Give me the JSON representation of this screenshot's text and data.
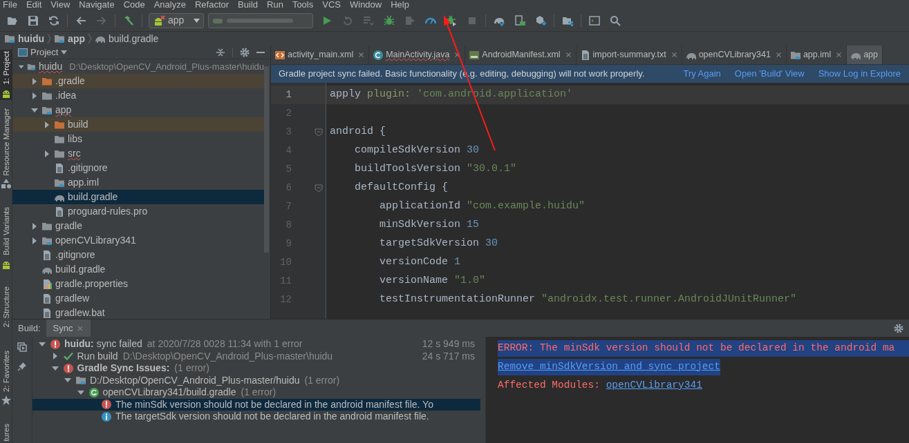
{
  "menu": [
    {
      "label": "File"
    },
    {
      "label": "Edit"
    },
    {
      "label": "View"
    },
    {
      "label": "Navigate"
    },
    {
      "label": "Code"
    },
    {
      "label": "Analyze"
    },
    {
      "label": "Refactor"
    },
    {
      "label": "Build"
    },
    {
      "label": "Run"
    },
    {
      "label": "Tools"
    },
    {
      "label": "VCS"
    },
    {
      "label": "Window"
    },
    {
      "label": "Help"
    }
  ],
  "toolbar": {
    "run_config": {
      "label": "app",
      "error": true
    }
  },
  "breadcrumb": [
    {
      "label": "huidu",
      "kind": "module",
      "bold": true
    },
    {
      "label": "app",
      "kind": "module",
      "bold": true
    },
    {
      "label": "build.gradle",
      "kind": "gradle",
      "bold": false
    }
  ],
  "tool_stripe": [
    {
      "label": "1: Project",
      "selected": true
    },
    {
      "label": "Resource Manager",
      "selected": false
    },
    {
      "label": "Build Variants",
      "selected": false
    },
    {
      "label": "2: Structure",
      "selected": false
    },
    {
      "label": "2: Favorites",
      "selected": false
    },
    {
      "label": "tures",
      "selected": false
    }
  ],
  "project_panel": {
    "title": "Project",
    "tree": [
      {
        "label": "huidu",
        "detail": "D:\\Desktop\\OpenCV_Android_Plus-master\\huidu",
        "kind": "module",
        "expanded": true,
        "error": true,
        "excluded": false,
        "selected": false,
        "children": [
          {
            "label": ".gradle",
            "kind": "folder",
            "expanded": false,
            "error": false,
            "excluded": true,
            "selected": false
          },
          {
            "label": ".idea",
            "kind": "folder",
            "expanded": false,
            "error": false,
            "excluded": false,
            "selected": false
          },
          {
            "label": "app",
            "kind": "module",
            "expanded": true,
            "error": true,
            "excluded": false,
            "selected": false,
            "children": [
              {
                "label": "build",
                "kind": "folder",
                "expanded": false,
                "error": false,
                "excluded": true,
                "selected": false
              },
              {
                "label": "libs",
                "kind": "folder",
                "error": false,
                "excluded": false,
                "selected": false
              },
              {
                "label": "src",
                "kind": "folder",
                "expanded": false,
                "error": true,
                "excluded": false,
                "selected": false
              },
              {
                "label": ".gitignore",
                "kind": "file",
                "error": false,
                "excluded": false,
                "selected": false
              },
              {
                "label": "app.iml",
                "kind": "module",
                "error": false,
                "excluded": false,
                "selected": false
              },
              {
                "label": "build.gradle",
                "kind": "gradle",
                "error": false,
                "excluded": false,
                "selected": true
              },
              {
                "label": "proguard-rules.pro",
                "kind": "file",
                "error": false,
                "excluded": false,
                "selected": false
              }
            ]
          },
          {
            "label": "gradle",
            "kind": "folder",
            "expanded": false,
            "error": false,
            "excluded": false,
            "selected": false
          },
          {
            "label": "openCVLibrary341",
            "kind": "module",
            "expanded": false,
            "error": false,
            "excluded": false,
            "selected": false
          },
          {
            "label": ".gitignore",
            "kind": "file",
            "error": false,
            "excluded": false,
            "selected": false
          },
          {
            "label": "build.gradle",
            "kind": "gradle",
            "error": false,
            "excluded": false,
            "selected": false
          },
          {
            "label": "gradle.properties",
            "kind": "properties",
            "error": false,
            "excluded": false,
            "selected": false
          },
          {
            "label": "gradlew",
            "kind": "file",
            "error": false,
            "excluded": false,
            "selected": false
          },
          {
            "label": "gradlew.bat",
            "kind": "file",
            "error": false,
            "excluded": false,
            "selected": false
          }
        ]
      }
    ]
  },
  "editor_tabs": [
    {
      "label": "activity_main.xml",
      "kind": "layout",
      "selected": false,
      "error": false
    },
    {
      "label": "MainActivity.java",
      "kind": "java",
      "selected": false,
      "error": true
    },
    {
      "label": "AndroidManifest.xml",
      "kind": "manifest",
      "selected": false,
      "error": false
    },
    {
      "label": "import-summary.txt",
      "kind": "file",
      "selected": false,
      "error": false
    },
    {
      "label": "openCVLibrary341",
      "kind": "gradle",
      "selected": false,
      "error": false
    },
    {
      "label": "app.iml",
      "kind": "module",
      "selected": false,
      "error": false
    },
    {
      "label": "app",
      "kind": "gradle",
      "selected": true,
      "error": false
    }
  ],
  "banner": {
    "message": "Gradle project sync failed. Basic functionality (e.g. editing, debugging) will not work properly.",
    "links": [
      "Try Again",
      "Open 'Build' View",
      "Show Log in Explore"
    ]
  },
  "code": [
    {
      "number": "1",
      "current": true,
      "fold": false,
      "tokens": [
        {
          "kind": "plain",
          "text": "apply "
        },
        {
          "kind": "label",
          "text": "plugin: "
        },
        {
          "kind": "string",
          "text": "'com.android.application'"
        }
      ]
    },
    {
      "number": "2",
      "current": false,
      "fold": false
    },
    {
      "number": "3",
      "current": false,
      "fold": true,
      "tokens": [
        {
          "kind": "plain",
          "text": "android {"
        }
      ]
    },
    {
      "number": "4",
      "current": false,
      "fold": false,
      "tokens": [
        {
          "kind": "plain",
          "text": "    compileSdkVersion "
        },
        {
          "kind": "number",
          "text": "30"
        }
      ]
    },
    {
      "number": "5",
      "current": false,
      "fold": false,
      "tokens": [
        {
          "kind": "plain",
          "text": "    buildToolsVersion "
        },
        {
          "kind": "string",
          "text": "\"30.0.1\""
        }
      ]
    },
    {
      "number": "6",
      "current": false,
      "fold": true,
      "tokens": [
        {
          "kind": "plain",
          "text": "    defaultConfig {"
        }
      ]
    },
    {
      "number": "7",
      "current": false,
      "fold": false,
      "tokens": [
        {
          "kind": "plain",
          "text": "        applicationId "
        },
        {
          "kind": "string",
          "text": "\"com.example.huidu\""
        }
      ]
    },
    {
      "number": "8",
      "current": false,
      "fold": false,
      "tokens": [
        {
          "kind": "plain",
          "text": "        minSdkVersion "
        },
        {
          "kind": "number",
          "text": "15"
        }
      ]
    },
    {
      "number": "9",
      "current": false,
      "fold": false,
      "tokens": [
        {
          "kind": "plain",
          "text": "        targetSdkVersion "
        },
        {
          "kind": "number",
          "text": "30"
        }
      ]
    },
    {
      "number": "10",
      "current": false,
      "fold": false,
      "tokens": [
        {
          "kind": "plain",
          "text": "        versionCode "
        },
        {
          "kind": "number",
          "text": "1"
        }
      ]
    },
    {
      "number": "11",
      "current": false,
      "fold": false,
      "tokens": [
        {
          "kind": "plain",
          "text": "        versionName "
        },
        {
          "kind": "string",
          "text": "\"1.0\""
        }
      ]
    },
    {
      "number": "12",
      "current": false,
      "fold": false,
      "tokens": [
        {
          "kind": "plain",
          "text": "        testInstrumentationRunner "
        },
        {
          "kind": "string",
          "text": "\"androidx.test.runner.AndroidJUnitRunner\""
        }
      ]
    }
  ],
  "build_panel": {
    "label": "Build:",
    "tabs": [
      {
        "label": "Sync",
        "selected": true
      }
    ],
    "tree": [
      {
        "kind": "error",
        "title": "**huidu:** sync failed",
        "bold": false,
        "detail": "at 2020/7/28 0028 11:34  with 1 error",
        "duration": "12 s 949 ms",
        "expanded": true,
        "selected": false,
        "children": [
          {
            "kind": "success",
            "title": "Run build",
            "bold": false,
            "detail": "D:\\Desktop\\OpenCV_Android_Plus-master\\huidu",
            "duration": "24 s 717 ms",
            "expanded": false,
            "selected": false
          },
          {
            "kind": "error",
            "title": "Gradle Sync Issues:",
            "bold": true,
            "detail": "(1 error)",
            "expanded": true,
            "selected": false,
            "children": [
              {
                "kind": "module",
                "title": "D:/Desktop/OpenCV_Android_Plus-master/huidu",
                "bold": false,
                "detail": "(1 error)",
                "expanded": true,
                "selected": false,
                "children": [
                  {
                    "kind": "gradle-file",
                    "title": "openCVLibrary341/build.gradle",
                    "bold": false,
                    "detail": "(1 error)",
                    "expanded": true,
                    "selected": false,
                    "children": [
                      {
                        "kind": "error",
                        "title": "The minSdk version should not be declared in the android manifest file. Yo",
                        "bold": false,
                        "selected": true
                      },
                      {
                        "kind": "info",
                        "title": "The targetSdk version should not be declared in the android manifest file.",
                        "bold": false,
                        "selected": false
                      }
                    ]
                  }
                ]
              }
            ]
          }
        ]
      }
    ],
    "console": [
      {
        "kind": "error",
        "text": "ERROR: The minSdk version should not be declared in the android ma",
        "selected": true
      },
      {
        "kind": "link",
        "text": "Remove minSdkVersion and sync project",
        "selected": true
      },
      {
        "kind": "modules",
        "text": "Affected Modules: ",
        "link": "openCVLibrary341",
        "selected": false
      }
    ]
  }
}
